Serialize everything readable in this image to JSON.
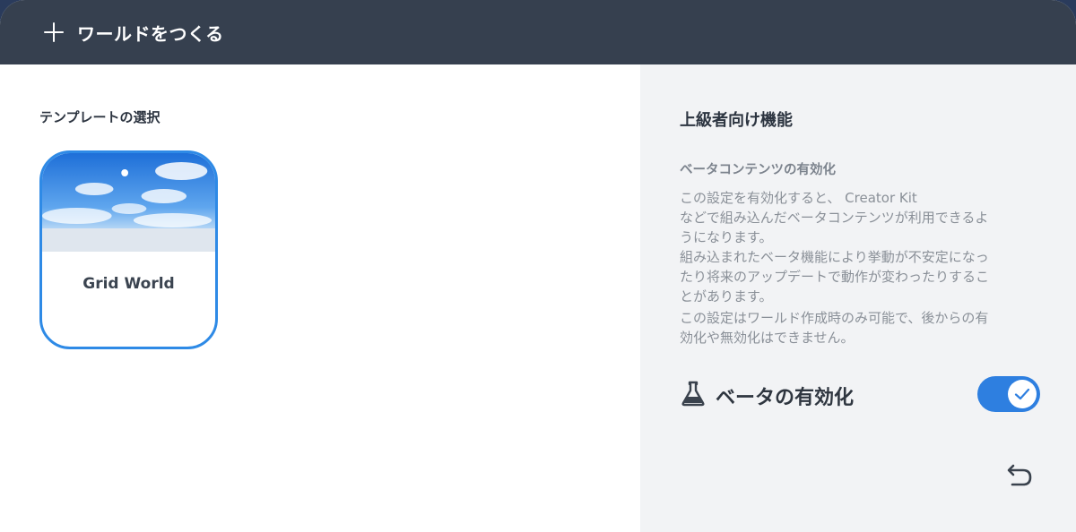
{
  "header": {
    "title": "ワールドをつくる",
    "icon": "plus-icon"
  },
  "template_section": {
    "label": "テンプレートの選択",
    "templates": [
      {
        "name": "Grid World",
        "selected": true
      }
    ]
  },
  "advanced": {
    "title": "上級者向け機能",
    "beta_heading": "ベータコンテンツの有効化",
    "desc1_line1": "この設定を有効化すると、 Creator Kit",
    "desc1_line2": "などで組み込んだベータコンテンツが利用できるよ",
    "desc1_line3": "うになります。",
    "desc2_line1": "組み込まれたベータ機能により挙動が不安定になっ",
    "desc2_line2": "たり将来のアップデートで動作が変わったりするこ",
    "desc2_line3": "とがあります。",
    "desc3_line1": "この設定はワールド作成時のみ可能で、後からの有",
    "desc3_line2": "効化や無効化はできません。",
    "toggle_label": "ベータの有効化",
    "toggle_on": true
  },
  "colors": {
    "header_bg": "#36404f",
    "accent": "#2e7fe0",
    "card_border": "#2e8ae6",
    "right_pane_bg": "#f2f3f5"
  }
}
